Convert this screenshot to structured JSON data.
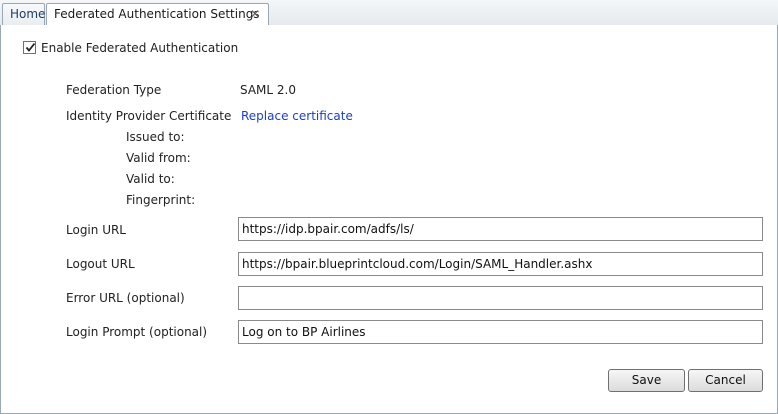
{
  "tabs": {
    "home": "Home",
    "active": "Federated Authentication Settings",
    "close_glyph": "✕"
  },
  "form": {
    "enable_label": "Enable Federated Authentication",
    "enable_checked": true,
    "federation_type_label": "Federation Type",
    "federation_type_value": "SAML 2.0",
    "idp_cert_label": "Identity Provider Certificate",
    "replace_cert_link": "Replace certificate",
    "issued_to_label": "Issued to:",
    "valid_from_label": "Valid from:",
    "valid_to_label": "Valid to:",
    "fingerprint_label": "Fingerprint:",
    "login_url_label": "Login URL",
    "login_url_value": "https://idp.bpair.com/adfs/ls/",
    "logout_url_label": "Logout URL",
    "logout_url_value": "https://bpair.blueprintcloud.com/Login/SAML_Handler.ashx",
    "error_url_label": "Error URL (optional)",
    "error_url_value": "",
    "login_prompt_label": "Login Prompt (optional)",
    "login_prompt_value": "Log on to BP Airlines"
  },
  "buttons": {
    "save": "Save",
    "cancel": "Cancel"
  },
  "colors": {
    "link": "#1a3fc7",
    "border": "#9aa7b4"
  }
}
